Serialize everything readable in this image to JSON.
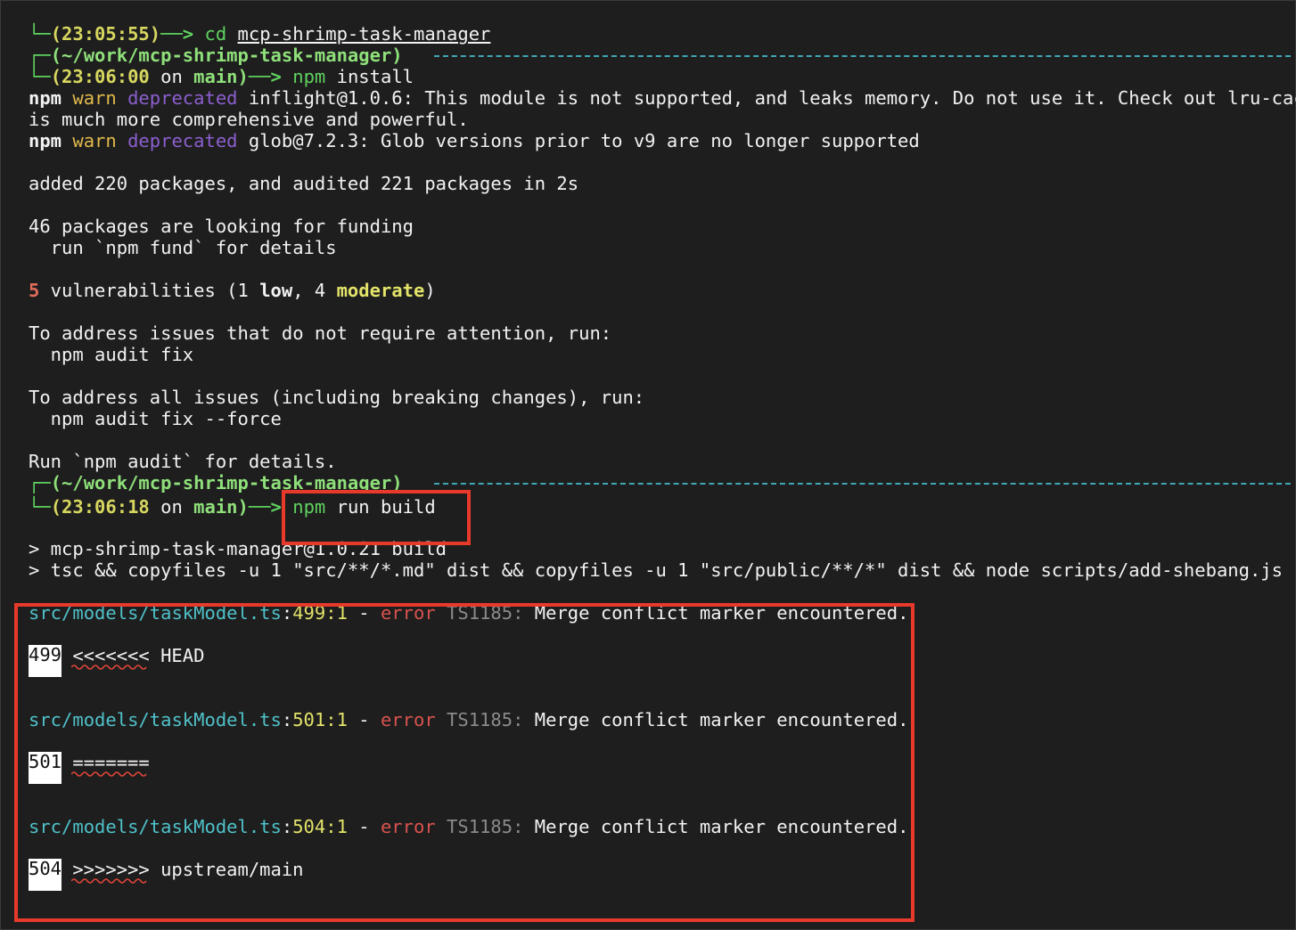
{
  "lines": {
    "l1": {
      "corner": "└─",
      "ts": "(23:05:55)",
      "arrow": "──>",
      "cmd": " cd ",
      "arg": "mcp-shrimp-task-manager"
    },
    "l2": {
      "corner": "┌─",
      "path": "(~/work/mcp-shrimp-task-manager)"
    },
    "l3": {
      "corner": "└─",
      "ts": "(23:06:00",
      "on": " on ",
      "branch": "main)",
      "arrow": "──>",
      "cmd": " npm",
      "rest": " install"
    },
    "w1": {
      "npm": "npm",
      "warn": " warn ",
      "dep": "deprecated",
      "msg": " inflight@1.0.6: This module is not supported, and leaks memory. Do not use it. Check out lru-cac"
    },
    "w1b": "is much more comprehensive and powerful.",
    "w2": {
      "npm": "npm",
      "warn": " warn ",
      "dep": "deprecated",
      "msg": " glob@7.2.3: Glob versions prior to v9 are no longer supported"
    },
    "added": "added 220 packages, and audited 221 packages in 2s",
    "fund1": "46 packages are looking for funding",
    "fund2": "  run `npm fund` for details",
    "vuln": {
      "count": "5",
      "a": " vulnerabilities (1 ",
      "low": "low",
      "b": ", 4 ",
      "moderate": "moderate",
      "c": ")"
    },
    "addr1": "To address issues that do not require attention, run:",
    "addr1b": "  npm audit fix",
    "addr2": "To address all issues (including breaking changes), run:",
    "addr2b": "  npm audit fix --force",
    "run": "Run `npm audit` for details.",
    "l4": {
      "corner": "┌─",
      "path": "(~/work/mcp-shrimp-task-manager)"
    },
    "l5": {
      "corner": "└─",
      "ts": "(23:06:18",
      "on": " on ",
      "branch": "main)",
      "arrow": "──>",
      "cmd": " npm",
      "rest": " run build"
    },
    "b1": "> mcp-shrimp-task-manager@1.0.21 build",
    "b2": "> tsc && copyfiles -u 1 \"src/**/*.md\" dist && copyfiles -u 1 \"src/public/**/*\" dist && node scripts/add-shebang.js"
  },
  "errors": [
    {
      "file": "src/models/taskModel.ts",
      "loc": "499:1",
      "sep": " - ",
      "level": "error",
      "code": " TS1185:",
      "msg": " Merge conflict marker encountered.",
      "num": "499",
      "src": " <<<<<<< HEAD"
    },
    {
      "file": "src/models/taskModel.ts",
      "loc": "501:1",
      "sep": " - ",
      "level": "error",
      "code": " TS1185:",
      "msg": " Merge conflict marker encountered.",
      "num": "501",
      "src": " ======="
    },
    {
      "file": "src/models/taskModel.ts",
      "loc": "504:1",
      "sep": " - ",
      "level": "error",
      "code": " TS1185:",
      "msg": " Merge conflict marker encountered.",
      "num": "504",
      "src": " >>>>>>> upstream/main"
    }
  ],
  "colors": {
    "highlight": "#e83a2a",
    "background": "#1e1e1e",
    "prompt": "#5fd35f"
  }
}
